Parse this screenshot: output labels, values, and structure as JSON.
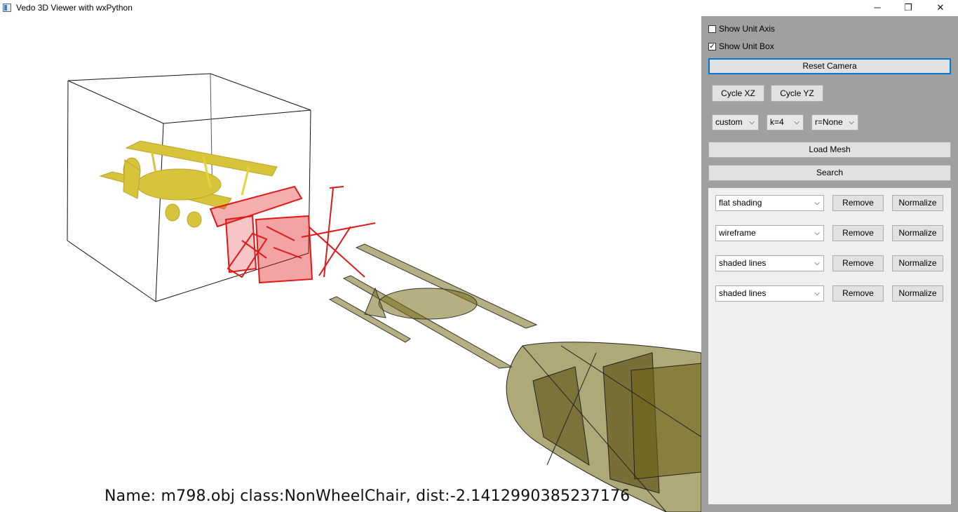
{
  "window": {
    "title": "Vedo 3D Viewer with wxPython",
    "minimize_glyph": "─",
    "maximize_glyph": "❐",
    "close_glyph": "✕"
  },
  "viewport": {
    "status_text": "Name: m798.obj class:NonWheelChair, dist:-2.1412990385237176"
  },
  "controls": {
    "show_unit_axis": {
      "label": "Show Unit Axis",
      "checked": false
    },
    "show_unit_box": {
      "label": "Show Unit Box",
      "checked": true
    },
    "reset_camera": "Reset Camera",
    "cycle_xz": "Cycle XZ",
    "cycle_yz": "Cycle YZ",
    "mode_select": "custom",
    "k_select": "k=4",
    "r_select": "r=None",
    "load_mesh": "Load Mesh",
    "search": "Search"
  },
  "mesh_rows": [
    {
      "shading": "flat shading",
      "remove": "Remove",
      "normalize": "Normalize"
    },
    {
      "shading": "wireframe",
      "remove": "Remove",
      "normalize": "Normalize"
    },
    {
      "shading": "shaded lines",
      "remove": "Remove",
      "normalize": "Normalize"
    },
    {
      "shading": "shaded lines",
      "remove": "Remove",
      "normalize": "Normalize"
    }
  ],
  "colors": {
    "panel_bg": "#a0a0a0",
    "list_bg": "#efefef",
    "mesh_yellow": "#d8c43a",
    "mesh_red": "#e01818",
    "mesh_olive": "#7a6e1c"
  },
  "icons": {
    "dropdown": "chevron-down-icon",
    "app": "app-window-icon"
  }
}
